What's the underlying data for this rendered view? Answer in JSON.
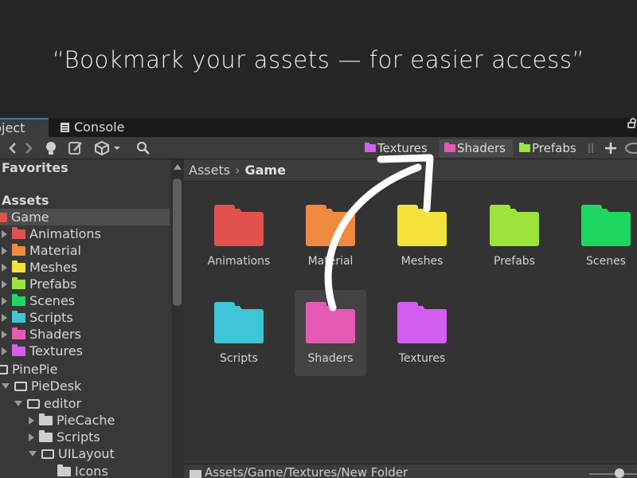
{
  "banner": {
    "text": "“Bookmark your assets — for easier access”"
  },
  "tabs": {
    "project": "roject",
    "console": "Console"
  },
  "bookmarks": [
    {
      "label": "Textures",
      "color": "#d35ef0"
    },
    {
      "label": "Shaders",
      "color": "#e55bb4"
    },
    {
      "label": "Prefabs",
      "color": "#9ae43c"
    }
  ],
  "sidebar": {
    "favorites": "Favorites",
    "assets": "Assets",
    "game": {
      "label": "Game",
      "color": "#e1524c"
    },
    "children": [
      {
        "label": "Animations",
        "color": "#e1524c"
      },
      {
        "label": "Material",
        "color": "#f08a40"
      },
      {
        "label": "Meshes",
        "color": "#f2e23a"
      },
      {
        "label": "Prefabs",
        "color": "#9ae43c"
      },
      {
        "label": "Scenes",
        "color": "#1ed760"
      },
      {
        "label": "Scripts",
        "color": "#3ec6d8"
      },
      {
        "label": "Shaders",
        "color": "#e55bb4"
      },
      {
        "label": "Textures",
        "color": "#d35ef0"
      }
    ],
    "pinepie": "PinePie",
    "piedesk": "PieDesk",
    "editor": "editor",
    "piecache": "PieCache",
    "scripts": "Scripts",
    "uilayout": "UILayout",
    "icons": "Icons"
  },
  "breadcrumb": {
    "root": "Assets",
    "current": "Game"
  },
  "grid": [
    {
      "label": "Animations",
      "color": "#e1524c"
    },
    {
      "label": "Material",
      "color": "#f08a40"
    },
    {
      "label": "Meshes",
      "color": "#f2e23a"
    },
    {
      "label": "Prefabs",
      "color": "#9ae43c"
    },
    {
      "label": "Scenes",
      "color": "#1ed760"
    },
    {
      "label": "Scripts",
      "color": "#3ec6d8"
    },
    {
      "label": "Shaders",
      "color": "#e55bb4"
    },
    {
      "label": "Textures",
      "color": "#d35ef0"
    }
  ],
  "status": {
    "path": "Assets/Game/Textures/New Folder"
  }
}
